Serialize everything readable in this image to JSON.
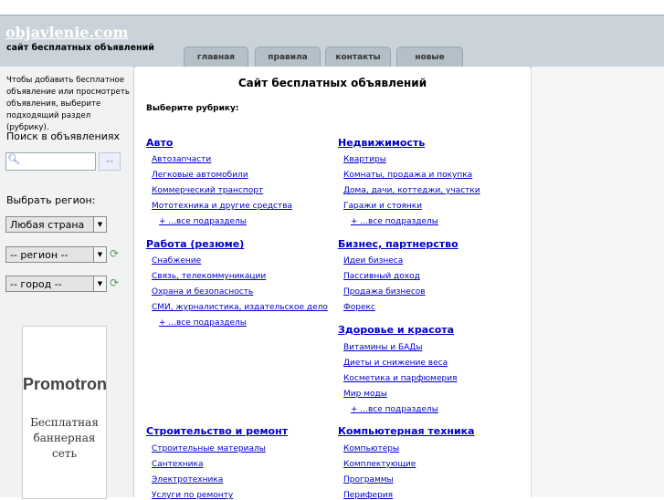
{
  "header": {
    "logo": "objavlenie.com",
    "tagline": "сайт бесплатных объявлений",
    "tabs": [
      "главная",
      "правила",
      "контакты",
      "новые"
    ]
  },
  "sidebar": {
    "intro": "Чтобы добавить бесплатное объявление или просмотреть объявления, выберите подходящий раздел (рубрику).",
    "search_heading": "Поиск в объявлениях",
    "search_button": "»»",
    "region_heading": "Выбрать регион:",
    "country_select": "Любая страна",
    "region_select": "-- регион --",
    "city_select": "-- город --",
    "banner_brand": "Promotron",
    "banner_text": "Бесплатная баннерная сеть"
  },
  "main": {
    "title": "Сайт бесплатных объявлений",
    "choose_label": "Выберите рубрику:",
    "left_col": [
      {
        "title": "Авто",
        "items": [
          "Автозапчасти",
          "Легковые автомобили",
          "Коммерческий транспорт",
          "Мототехника и другие средства"
        ],
        "more": "+ ...все подразделы"
      },
      {
        "title": "Работа (резюме)",
        "items": [
          "Снабжение",
          "Связь, телекоммуникации",
          "Охрана и безопасность",
          "СМИ, журналистика, издательское дело"
        ],
        "more": "+ ...все подразделы"
      },
      {
        "title": "Строительство и ремонт",
        "items": [
          "Строительные материалы",
          "Сантехника",
          "Электротехника",
          "Услуги по ремонту"
        ]
      }
    ],
    "right_col": [
      {
        "title": "Недвижимость",
        "items": [
          "Квартиры",
          "Комнаты, продажа и покупка",
          "Дома, дачи, коттеджи, участки",
          "Гаражи и стоянки"
        ],
        "more": "+ ...все подразделы"
      },
      {
        "title": "Бизнес, партнерство",
        "items": [
          "Идеи бизнеса",
          "Пассивный доход",
          "Продажа бизнесов",
          "Форекс"
        ]
      },
      {
        "title": "Здоровье и красота",
        "items": [
          "Витамины и БАДы",
          "Диеты и снижение веса",
          "Косметика и парфюмерия",
          "Мир моды"
        ],
        "more": "+ ...все подразделы"
      },
      {
        "title": "Компьютерная техника",
        "items": [
          "Компьютеры",
          "Комплектующие",
          "Программы",
          "Периферия"
        ]
      }
    ]
  }
}
